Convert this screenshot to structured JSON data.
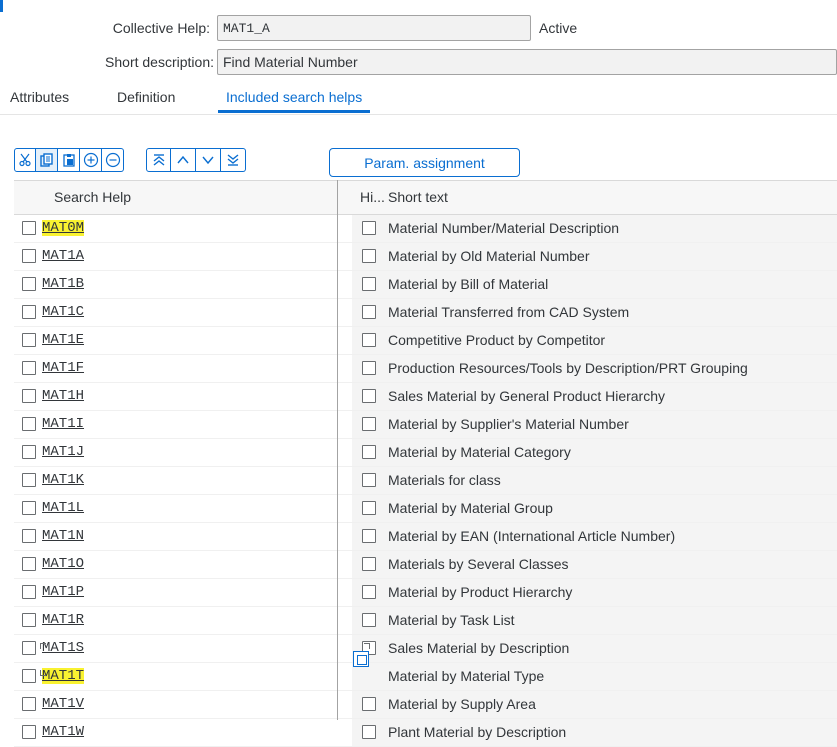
{
  "header": {
    "collective_label": "Collective Help:",
    "collective_value": "MAT1_A",
    "status": "Active",
    "short_desc_label": "Short description:",
    "short_desc_value": "Find Material Number"
  },
  "tabs": [
    {
      "label": "Attributes",
      "active": false
    },
    {
      "label": "Definition",
      "active": false
    },
    {
      "label": "Included search helps",
      "active": true
    }
  ],
  "toolbar": {
    "icons": [
      "cut-icon",
      "copy-icon",
      "paste-icon",
      "insert-row-icon",
      "delete-row-icon",
      "first-page-icon",
      "previous-icon",
      "next-icon",
      "last-page-icon"
    ],
    "param_label": "Param. assignment"
  },
  "table": {
    "columns": [
      "Search Help",
      "Hi...",
      "Short text"
    ],
    "rows": [
      {
        "name": "MAT0M",
        "text": "Material Number/Material Description",
        "highlight": true
      },
      {
        "name": "MAT1A",
        "text": "Material by Old Material Number",
        "highlight": false
      },
      {
        "name": "MAT1B",
        "text": "Material by Bill of Material",
        "highlight": false
      },
      {
        "name": "MAT1C",
        "text": "Material Transferred from CAD System",
        "highlight": false
      },
      {
        "name": "MAT1E",
        "text": "Competitive Product by Competitor",
        "highlight": false
      },
      {
        "name": "MAT1F",
        "text": "Production Resources/Tools by Description/PRT Grouping",
        "highlight": false
      },
      {
        "name": "MAT1H",
        "text": "Sales Material by General Product Hierarchy",
        "highlight": false
      },
      {
        "name": "MAT1I",
        "text": "Material by Supplier's Material Number",
        "highlight": false
      },
      {
        "name": "MAT1J",
        "text": "Material by Material Category",
        "highlight": false
      },
      {
        "name": "MAT1K",
        "text": "Materials for class",
        "highlight": false
      },
      {
        "name": "MAT1L",
        "text": "Material by Material Group",
        "highlight": false
      },
      {
        "name": "MAT1N",
        "text": "Material by EAN (International Article Number)",
        "highlight": false
      },
      {
        "name": "MAT1O",
        "text": "Materials by Several Classes",
        "highlight": false
      },
      {
        "name": "MAT1P",
        "text": "Material by Product Hierarchy",
        "highlight": false
      },
      {
        "name": "MAT1R",
        "text": "Material by Task List",
        "highlight": false
      },
      {
        "name": "MAT1S",
        "text": "Sales Material by Description",
        "highlight": false
      },
      {
        "name": "MAT1T",
        "text": "Material by Material Type",
        "highlight": true
      },
      {
        "name": "MAT1V",
        "text": "Material by Supply Area",
        "highlight": false
      },
      {
        "name": "MAT1W",
        "text": "Plant Material by Description",
        "highlight": false
      }
    ]
  },
  "colors": {
    "accent": "#0a6ed1",
    "highlight": "#f9f231"
  }
}
